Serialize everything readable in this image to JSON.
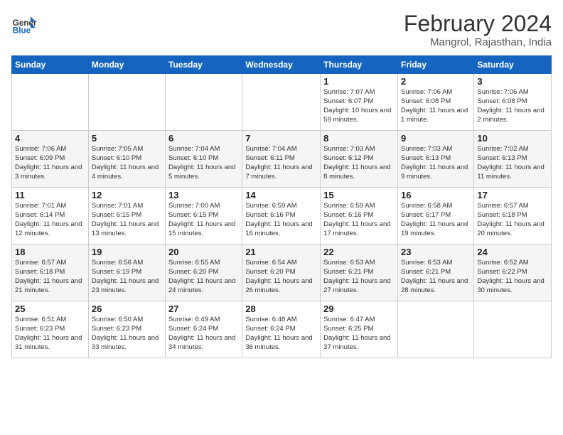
{
  "logo": {
    "text_general": "General",
    "text_blue": "Blue"
  },
  "title": "February 2024",
  "subtitle": "Mangrol, Rajasthan, India",
  "days_of_week": [
    "Sunday",
    "Monday",
    "Tuesday",
    "Wednesday",
    "Thursday",
    "Friday",
    "Saturday"
  ],
  "weeks": [
    [
      {
        "day": "",
        "info": ""
      },
      {
        "day": "",
        "info": ""
      },
      {
        "day": "",
        "info": ""
      },
      {
        "day": "",
        "info": ""
      },
      {
        "day": "1",
        "info": "Sunrise: 7:07 AM\nSunset: 6:07 PM\nDaylight: 10 hours and 59 minutes."
      },
      {
        "day": "2",
        "info": "Sunrise: 7:06 AM\nSunset: 6:08 PM\nDaylight: 11 hours and 1 minute."
      },
      {
        "day": "3",
        "info": "Sunrise: 7:06 AM\nSunset: 6:08 PM\nDaylight: 11 hours and 2 minutes."
      }
    ],
    [
      {
        "day": "4",
        "info": "Sunrise: 7:06 AM\nSunset: 6:09 PM\nDaylight: 11 hours and 3 minutes."
      },
      {
        "day": "5",
        "info": "Sunrise: 7:05 AM\nSunset: 6:10 PM\nDaylight: 11 hours and 4 minutes."
      },
      {
        "day": "6",
        "info": "Sunrise: 7:04 AM\nSunset: 6:10 PM\nDaylight: 11 hours and 5 minutes."
      },
      {
        "day": "7",
        "info": "Sunrise: 7:04 AM\nSunset: 6:11 PM\nDaylight: 11 hours and 7 minutes."
      },
      {
        "day": "8",
        "info": "Sunrise: 7:03 AM\nSunset: 6:12 PM\nDaylight: 11 hours and 8 minutes."
      },
      {
        "day": "9",
        "info": "Sunrise: 7:03 AM\nSunset: 6:13 PM\nDaylight: 11 hours and 9 minutes."
      },
      {
        "day": "10",
        "info": "Sunrise: 7:02 AM\nSunset: 6:13 PM\nDaylight: 11 hours and 11 minutes."
      }
    ],
    [
      {
        "day": "11",
        "info": "Sunrise: 7:01 AM\nSunset: 6:14 PM\nDaylight: 11 hours and 12 minutes."
      },
      {
        "day": "12",
        "info": "Sunrise: 7:01 AM\nSunset: 6:15 PM\nDaylight: 11 hours and 13 minutes."
      },
      {
        "day": "13",
        "info": "Sunrise: 7:00 AM\nSunset: 6:15 PM\nDaylight: 11 hours and 15 minutes."
      },
      {
        "day": "14",
        "info": "Sunrise: 6:59 AM\nSunset: 6:16 PM\nDaylight: 11 hours and 16 minutes."
      },
      {
        "day": "15",
        "info": "Sunrise: 6:59 AM\nSunset: 6:16 PM\nDaylight: 11 hours and 17 minutes."
      },
      {
        "day": "16",
        "info": "Sunrise: 6:58 AM\nSunset: 6:17 PM\nDaylight: 11 hours and 19 minutes."
      },
      {
        "day": "17",
        "info": "Sunrise: 6:57 AM\nSunset: 6:18 PM\nDaylight: 11 hours and 20 minutes."
      }
    ],
    [
      {
        "day": "18",
        "info": "Sunrise: 6:57 AM\nSunset: 6:18 PM\nDaylight: 11 hours and 21 minutes."
      },
      {
        "day": "19",
        "info": "Sunrise: 6:56 AM\nSunset: 6:19 PM\nDaylight: 11 hours and 23 minutes."
      },
      {
        "day": "20",
        "info": "Sunrise: 6:55 AM\nSunset: 6:20 PM\nDaylight: 11 hours and 24 minutes."
      },
      {
        "day": "21",
        "info": "Sunrise: 6:54 AM\nSunset: 6:20 PM\nDaylight: 11 hours and 26 minutes."
      },
      {
        "day": "22",
        "info": "Sunrise: 6:53 AM\nSunset: 6:21 PM\nDaylight: 11 hours and 27 minutes."
      },
      {
        "day": "23",
        "info": "Sunrise: 6:53 AM\nSunset: 6:21 PM\nDaylight: 11 hours and 28 minutes."
      },
      {
        "day": "24",
        "info": "Sunrise: 6:52 AM\nSunset: 6:22 PM\nDaylight: 11 hours and 30 minutes."
      }
    ],
    [
      {
        "day": "25",
        "info": "Sunrise: 6:51 AM\nSunset: 6:23 PM\nDaylight: 11 hours and 31 minutes."
      },
      {
        "day": "26",
        "info": "Sunrise: 6:50 AM\nSunset: 6:23 PM\nDaylight: 11 hours and 33 minutes."
      },
      {
        "day": "27",
        "info": "Sunrise: 6:49 AM\nSunset: 6:24 PM\nDaylight: 11 hours and 34 minutes."
      },
      {
        "day": "28",
        "info": "Sunrise: 6:48 AM\nSunset: 6:24 PM\nDaylight: 11 hours and 36 minutes."
      },
      {
        "day": "29",
        "info": "Sunrise: 6:47 AM\nSunset: 6:25 PM\nDaylight: 11 hours and 37 minutes."
      },
      {
        "day": "",
        "info": ""
      },
      {
        "day": "",
        "info": ""
      }
    ]
  ]
}
